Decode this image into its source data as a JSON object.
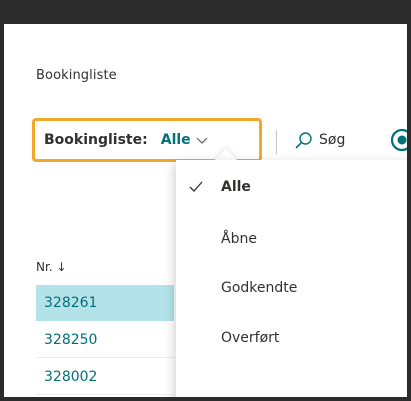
{
  "page": {
    "title": "Bookingliste"
  },
  "action_bar": {
    "view_label": "Bookingliste:",
    "view_value": "Alle",
    "search_label": "Søg"
  },
  "table": {
    "column_header": "Nr. ↓",
    "rows": [
      "328261",
      "328250",
      "328002"
    ]
  },
  "dropdown": {
    "items": [
      "Alle",
      "Åbne",
      "Godkendte",
      "Overført"
    ],
    "selected": "Alle"
  },
  "colors": {
    "accent": "#00707a",
    "highlight_border": "#f2a92b",
    "selected_row": "#b3e3e8"
  }
}
